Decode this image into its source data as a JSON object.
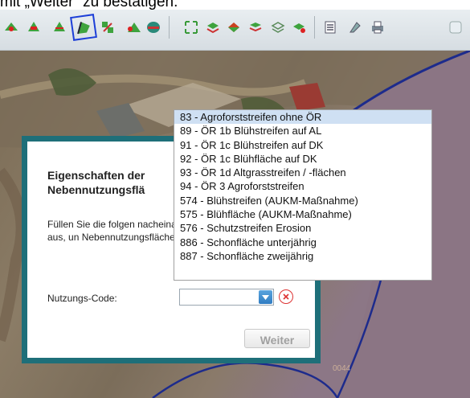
{
  "caption": "mit „Weiter“ zu bestätigen.",
  "toolbar": {
    "icons": [
      "node-add-icon",
      "node-edit-icon",
      "node-split-icon",
      "polygon-draw-icon",
      "polygon-merge-icon",
      "area-cut-icon",
      "area-hole-icon",
      "move-icon",
      "layer-stack-icon",
      "layer-add-icon",
      "layer-remove-icon",
      "layer-outline-icon",
      "layer-select-icon",
      "list-icon",
      "tools-icon",
      "print-icon",
      "zoom-icon"
    ]
  },
  "dialog": {
    "title": "Eigenschaften der Nebennutzungsflä",
    "text": "Füllen Sie die folgen nacheinander aus, un Nebennutzungsfläche",
    "nutzungs_label": "Nutzungs-Code:",
    "weiter_label": "Weiter"
  },
  "dropdown": {
    "items": [
      "83 - Agroforststreifen ohne ÖR",
      "89 - ÖR 1b Blühstreifen auf AL",
      "91 - ÖR 1c Blühstreifen auf DK",
      "92 - ÖR 1c Blühfläche auf DK",
      "93 - ÖR 1d Altgrasstreifen / -flächen",
      "94 - ÖR 3 Agroforststreifen",
      "574 - Blühstreifen (AUKM-Maßnahme)",
      "575 - Blühfläche (AUKM-Maßnahme)",
      "576 - Schutzstreifen Erosion",
      "886 - Schonfläche unterjährig",
      "887 - Schonfläche zweijährig"
    ],
    "selected_index": 0
  },
  "map_label": "0044",
  "colors": {
    "accent": "#1e6f79",
    "highlight": "#cfe0f3",
    "boundary": "#1d2b8c"
  }
}
